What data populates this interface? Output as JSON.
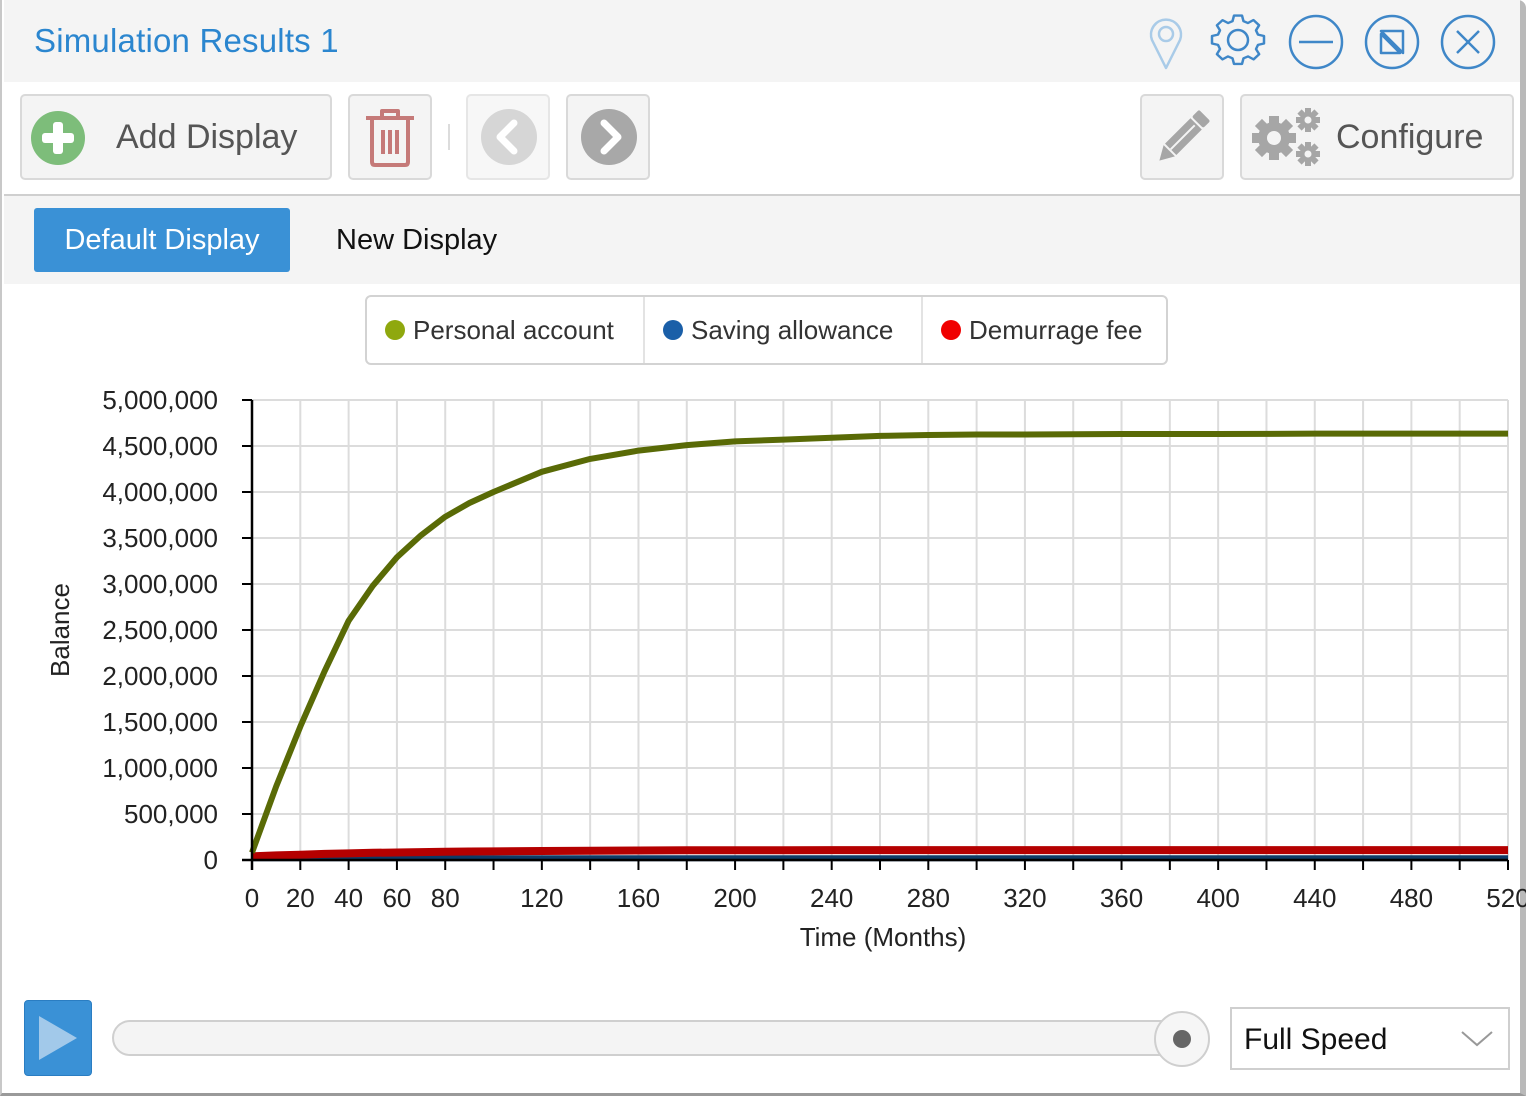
{
  "window": {
    "title": "Simulation Results 1",
    "title_icons": [
      {
        "name": "pin-icon",
        "label": "Pin"
      },
      {
        "name": "gear-icon",
        "label": "Settings"
      },
      {
        "name": "minimize-icon",
        "label": "Minimize"
      },
      {
        "name": "resize-icon",
        "label": "Resize"
      },
      {
        "name": "close-icon",
        "label": "Close"
      }
    ]
  },
  "toolbar": {
    "add_display_label": "Add Display",
    "configure_label": "Configure"
  },
  "tabs": [
    {
      "label": "Default Display",
      "active": true
    },
    {
      "label": "New Display",
      "active": false
    }
  ],
  "legend": [
    {
      "label": "Personal account",
      "color": "#8fa80e"
    },
    {
      "label": "Saving allowance",
      "color": "#1a5fa8"
    },
    {
      "label": "Demurrage fee",
      "color": "#f00000"
    }
  ],
  "chart_data": {
    "type": "line",
    "title": "",
    "xlabel": "Time (Months)",
    "ylabel": "Balance",
    "xlim": [
      0,
      520
    ],
    "ylim": [
      0,
      5000000
    ],
    "x_ticks": [
      0,
      20,
      40,
      60,
      80,
      100,
      120,
      140,
      160,
      180,
      200,
      220,
      240,
      260,
      280,
      300,
      320,
      340,
      360,
      380,
      400,
      420,
      440,
      460,
      480,
      500,
      520
    ],
    "x_tick_labels": [
      "0",
      "20",
      "40",
      "60",
      "80",
      "",
      "120",
      "",
      "160",
      "",
      "200",
      "",
      "240",
      "",
      "280",
      "",
      "320",
      "",
      "360",
      "",
      "400",
      "",
      "440",
      "",
      "480",
      "",
      "520"
    ],
    "y_ticks": [
      0,
      500000,
      1000000,
      1500000,
      2000000,
      2500000,
      3000000,
      3500000,
      4000000,
      4500000,
      5000000
    ],
    "y_tick_labels": [
      "0",
      "500,000",
      "1,000,000",
      "1,500,000",
      "2,000,000",
      "2,500,000",
      "3,000,000",
      "3,500,000",
      "4,000,000",
      "4,500,000",
      "5,000,000"
    ],
    "grid": true,
    "legend_position": "top-center",
    "x": [
      0,
      10,
      20,
      30,
      40,
      50,
      60,
      70,
      80,
      90,
      100,
      120,
      140,
      160,
      180,
      200,
      220,
      240,
      260,
      280,
      300,
      320,
      340,
      360,
      380,
      400,
      420,
      440,
      460,
      480,
      500,
      520
    ],
    "series": [
      {
        "name": "Personal account",
        "color": "#596a06",
        "values": [
          80000,
          800000,
          1450000,
          2050000,
          2600000,
          2980000,
          3290000,
          3530000,
          3730000,
          3880000,
          4000000,
          4220000,
          4360000,
          4450000,
          4510000,
          4550000,
          4570000,
          4590000,
          4610000,
          4620000,
          4625000,
          4625000,
          4628000,
          4630000,
          4630000,
          4630000,
          4632000,
          4635000,
          4635000,
          4635000,
          4635000,
          4635000
        ]
      },
      {
        "name": "Saving allowance",
        "color": "#0e3b66",
        "values": [
          20000,
          20000,
          20000,
          20000,
          20000,
          20000,
          20000,
          20000,
          20000,
          20000,
          20000,
          20000,
          20000,
          20000,
          20000,
          20000,
          20000,
          20000,
          20000,
          20000,
          20000,
          20000,
          20000,
          20000,
          20000,
          20000,
          20000,
          20000,
          20000,
          20000,
          20000,
          20000
        ]
      },
      {
        "name": "Demurrage fee",
        "color": "#b40000",
        "values": [
          40000,
          50000,
          58000,
          66000,
          72000,
          78000,
          82000,
          86000,
          89000,
          92000,
          94000,
          98000,
          101000,
          103000,
          105000,
          106000,
          107000,
          108000,
          108000,
          108000,
          108000,
          108000,
          108000,
          108000,
          108000,
          108000,
          108000,
          108000,
          108000,
          108000,
          108000,
          108000
        ]
      }
    ]
  },
  "playback": {
    "progress": 1.0,
    "speed_selected": "Full Speed"
  }
}
